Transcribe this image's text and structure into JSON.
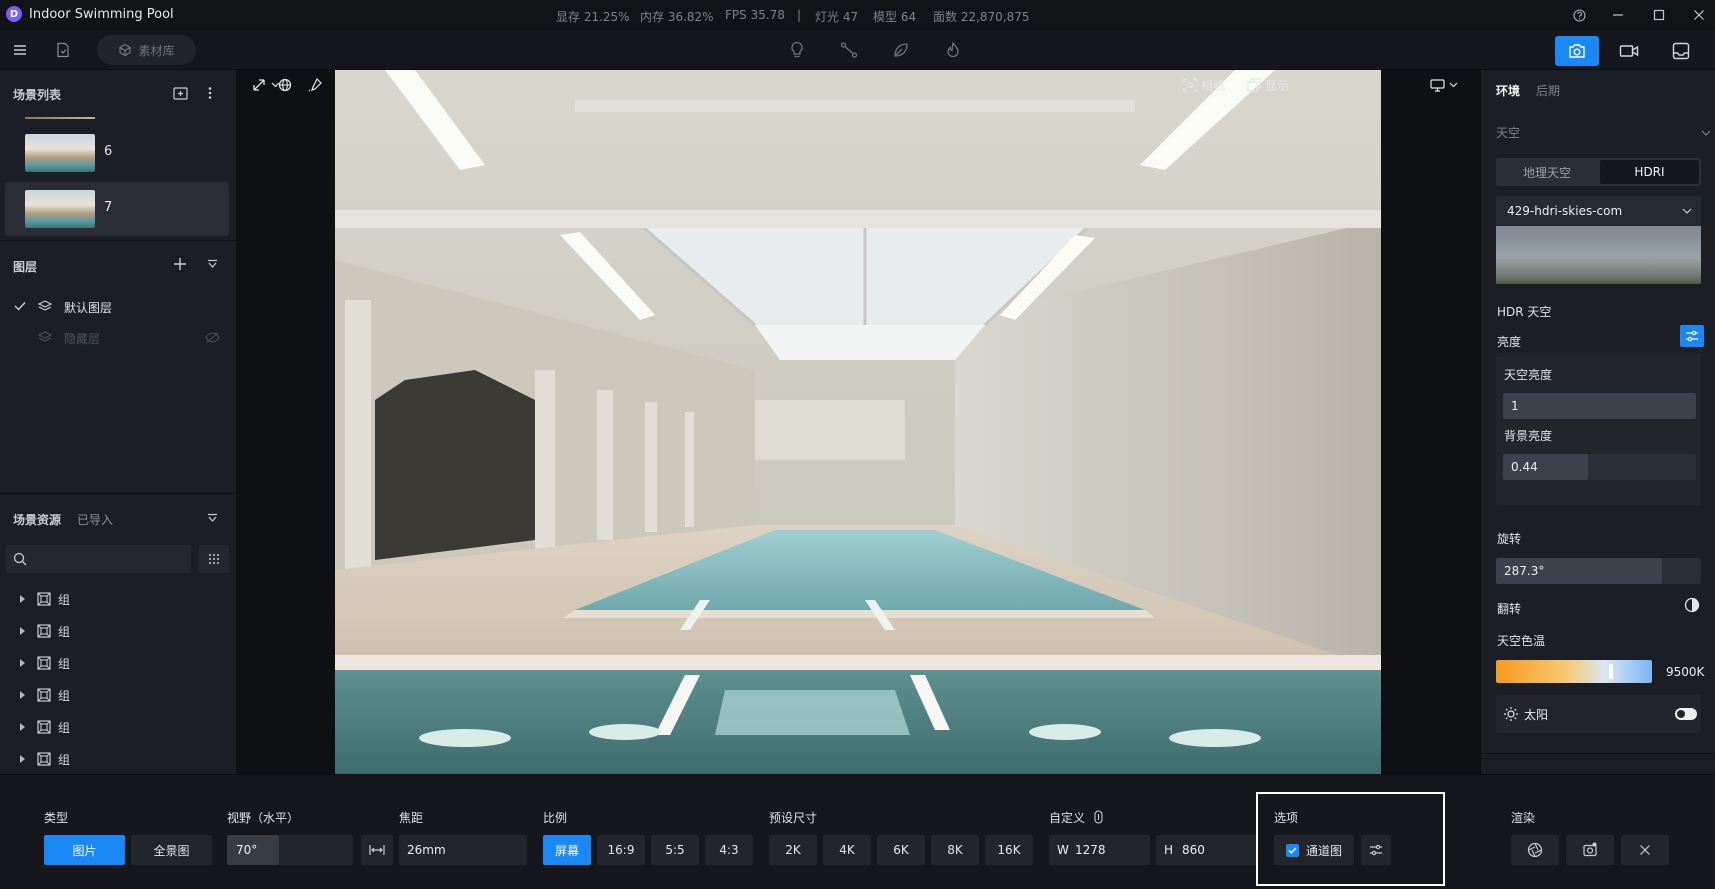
{
  "app": {
    "title": "Indoor Swimming Pool",
    "logo_letter": "D"
  },
  "stats": [
    "显存 21.25%",
    "内存 36.82%",
    "FPS 35.78",
    "|",
    "灯光 47",
    "模型 64",
    "面数 22,870,875"
  ],
  "toolbar": {
    "asset_library_label": "素材库"
  },
  "scene_list": {
    "title": "场景列表",
    "items": [
      {
        "label": "6"
      },
      {
        "label": "7"
      }
    ]
  },
  "layers": {
    "title": "图层",
    "items": [
      {
        "label": "默认图层"
      },
      {
        "label": "隐藏层"
      }
    ]
  },
  "scene_resources": {
    "tab_resources": "场景资源",
    "tab_imported": "已导入",
    "search_placeholder": "",
    "items": [
      {
        "label": "组"
      },
      {
        "label": "组"
      },
      {
        "label": "组"
      },
      {
        "label": "组"
      },
      {
        "label": "组"
      },
      {
        "label": "组"
      }
    ]
  },
  "viewport": {
    "camera_label": "相机",
    "display_label": "显示"
  },
  "right_panel": {
    "tab_env": "环境",
    "tab_post": "后期",
    "sky_section": "天空",
    "sky_toggle": [
      "地理天空",
      "HDRI"
    ],
    "hdri_name": "429-hdri-skies-com",
    "hdr_sky_label": "HDR 天空",
    "brightness_label": "亮度",
    "sky_brightness_label": "天空亮度",
    "sky_brightness_value": "1",
    "bg_brightness_label": "背景亮度",
    "bg_brightness_value": "0.44",
    "rotation_label": "旋转",
    "rotation_value": "287.3°",
    "flip_label": "翻转",
    "color_temp_label": "天空色温",
    "color_temp_value": "9500K",
    "color_temp_fraction": 0.74,
    "sun_label": "太阳"
  },
  "bottom": {
    "type_label": "类型",
    "type_options": [
      "图片",
      "全景图"
    ],
    "fov_label": "视野（水平）",
    "fov_value": "70°",
    "focal_label": "焦距",
    "focal_value": "26mm",
    "ratio_label": "比例",
    "ratio_options": [
      "屏幕",
      "16:9",
      "5:5",
      "4:3"
    ],
    "preset_label": "预设尺寸",
    "preset_options": [
      "2K",
      "4K",
      "6K",
      "8K",
      "16K"
    ],
    "custom_label": "自定义",
    "width_prefix": "W",
    "width_value": "1278",
    "height_prefix": "H",
    "height_value": "860",
    "options_label": "选项",
    "channel_label": "通道图",
    "render_label": "渲染"
  },
  "colors": {
    "accent": "#1a88f5",
    "panel": "#1b1e24",
    "background": "#15171c"
  }
}
